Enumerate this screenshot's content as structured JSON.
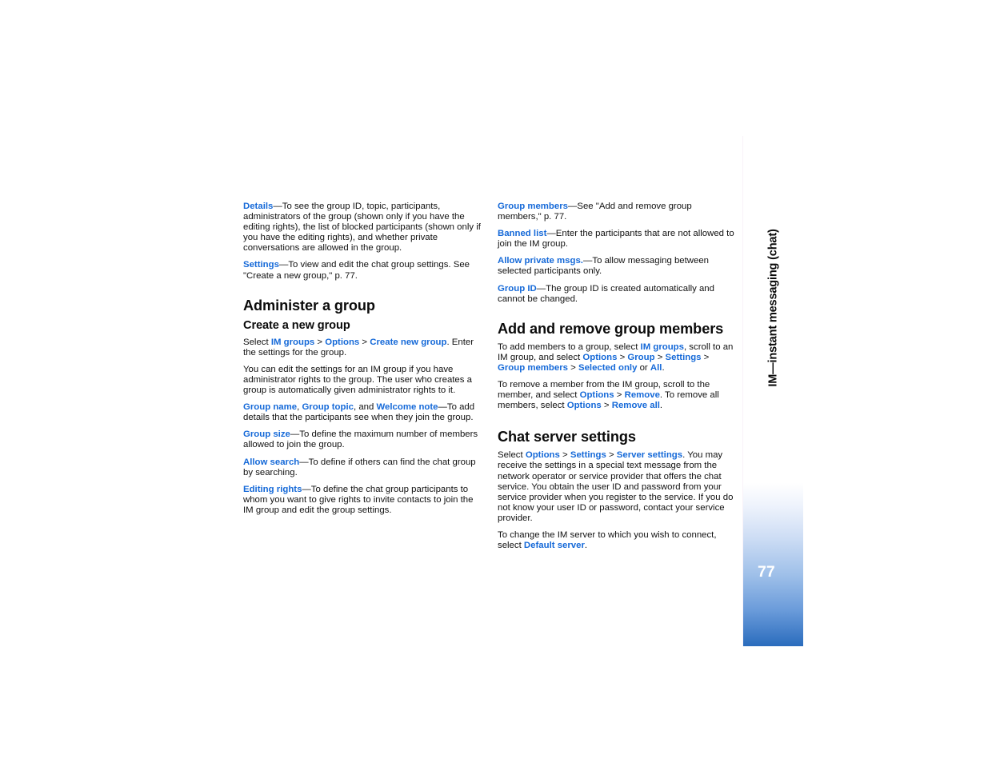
{
  "document": {
    "page_number": "77",
    "chapter_tab_label": "IM—instant messaging (chat)",
    "link_color": "#1569d8",
    "tab_gradient_end_color": "#2a6cbd"
  },
  "left_column": {
    "paragraphs": {
      "details": {
        "term": "Details",
        "body": "—To see the group ID, topic, participants, administrators of the group (shown only if you have the editing rights), the list of blocked participants (shown only if you have the editing rights), and whether private conversations are allowed in the group."
      },
      "settings": {
        "term": "Settings",
        "body": "—To view and edit the chat group settings. See \"Create a new group,\" p. 77."
      }
    },
    "heading_administer": "Administer a group",
    "subheading_create": "Create a new group",
    "create_select": {
      "lead": "Select ",
      "link1": "IM groups",
      "sep1": " > ",
      "link2": "Options",
      "sep2": " > ",
      "link3": "Create new group",
      "tail": ". Enter the settings for the group."
    },
    "edit_settings_note": "You can edit the settings for an IM group if you have administrator rights to the group. The user who creates a group is automatically given administrator rights to it.",
    "group_name_topic_welcome": {
      "link1": "Group name",
      "comma1": ", ",
      "link2": "Group topic",
      "and": ", and ",
      "link3": "Welcome note",
      "body": "—To add details that the participants see when they join the group."
    },
    "group_size": {
      "term": "Group size",
      "body": "—To define the maximum number of members allowed to join the group."
    },
    "allow_search": {
      "term": "Allow search",
      "body": "—To define if others can find the chat group by searching."
    },
    "editing_rights": {
      "term": "Editing rights",
      "body": "—To define the chat group participants to whom you want to give rights to invite contacts to join the IM group and edit the group settings."
    }
  },
  "right_column": {
    "group_members": {
      "term": "Group members",
      "body": "—See \"Add and remove group members,\" p. 77."
    },
    "banned_list": {
      "term": "Banned list",
      "body": "—Enter the participants that are not allowed to join the IM group."
    },
    "allow_private_msgs": {
      "term": "Allow private msgs.",
      "body": "—To allow messaging between selected participants only."
    },
    "group_id": {
      "term": "Group ID",
      "body": "—The group ID is created automatically and cannot be changed."
    },
    "heading_add_remove": "Add and remove group members",
    "add_members": {
      "lead": "To add members to a group, select ",
      "link1": "IM groups",
      "mid1": ", scroll to an IM group, and select ",
      "link2": "Options",
      "sep1": " > ",
      "link3": "Group",
      "sep2": " > ",
      "link4": "Settings",
      "sep3": " > ",
      "link5": "Group members",
      "sep4": " > ",
      "link6": "Selected only",
      "or": " or ",
      "link7": "All",
      "tail": "."
    },
    "remove_members": {
      "lead": "To remove a member from the IM group, scroll to the member, and select ",
      "link1": "Options",
      "sep1": " > ",
      "link2": "Remove",
      "mid": ". To remove all members, select ",
      "link3": "Options",
      "sep2": " > ",
      "link4": "Remove all",
      "tail": "."
    },
    "heading_chat_server": "Chat server settings",
    "server_settings": {
      "lead": "Select ",
      "link1": "Options",
      "sep1": " > ",
      "link2": "Settings",
      "sep2": " > ",
      "link3": "Server settings",
      "tail": ". You may receive the settings in a special text message from the network operator or service provider that offers the chat service. You obtain the user ID and password from your service provider when you register to the service. If you do not know your user ID or password, contact your service provider."
    },
    "default_server": {
      "lead": "To change the IM server to which you wish to connect, select ",
      "link1": "Default server",
      "tail": "."
    }
  }
}
